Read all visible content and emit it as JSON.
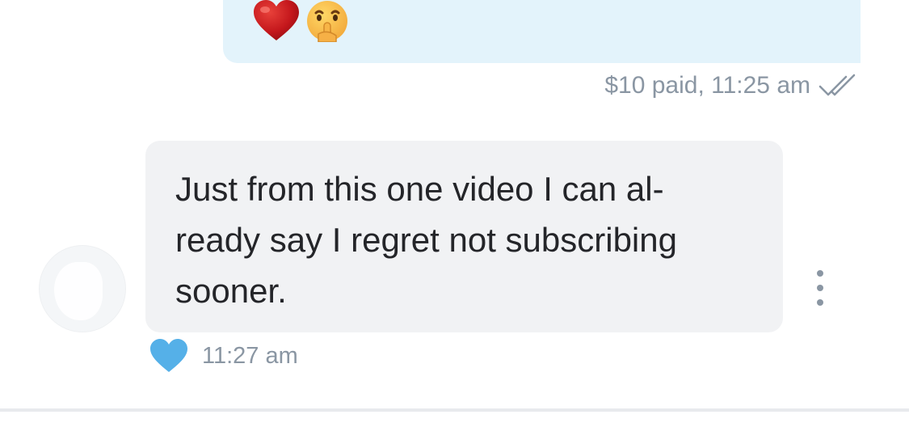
{
  "sent_message": {
    "emojis": [
      "red-heart",
      "shushing-face"
    ],
    "meta": "$10 paid, 11:25 am",
    "status_icon": "double-check-icon"
  },
  "received_message": {
    "text": "Just from this one video I can al-\nready say I regret not subscribing\nsooner.",
    "time": "11:27 am",
    "like_icon": "heart-icon"
  },
  "colors": {
    "sent_bubble": "#e3f3fb",
    "received_bubble": "#f1f2f4",
    "meta_text": "#8a96a3",
    "like_heart": "#55b0e8",
    "message_text": "#242529"
  }
}
